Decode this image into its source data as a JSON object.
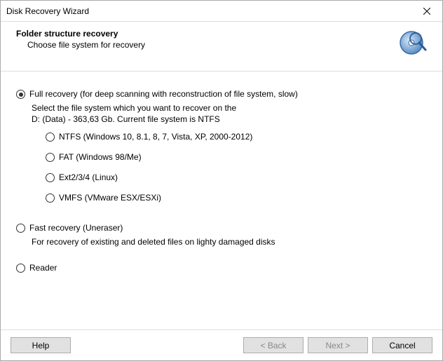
{
  "window": {
    "title": "Disk Recovery Wizard"
  },
  "header": {
    "heading": "Folder structure recovery",
    "sub": "Choose file system for recovery"
  },
  "options": {
    "full": {
      "label": "Full recovery (for deep scanning with reconstruction of file system, slow)",
      "desc_line1": "Select the file system which you want to recover on the",
      "desc_line2": "D: (Data) - 363,63 Gb. Current file system is NTFS",
      "selected": true,
      "fs": [
        {
          "label": "NTFS (Windows 10, 8.1, 8, 7, Vista, XP, 2000-2012)",
          "selected": false
        },
        {
          "label": "FAT (Windows 98/Me)",
          "selected": false
        },
        {
          "label": "Ext2/3/4 (Linux)",
          "selected": false
        },
        {
          "label": "VMFS (VMware ESX/ESXi)",
          "selected": false
        }
      ]
    },
    "fast": {
      "label": "Fast recovery (Uneraser)",
      "desc": "For recovery of existing and deleted files on lighty damaged disks",
      "selected": false
    },
    "reader": {
      "label": "Reader",
      "selected": false
    }
  },
  "footer": {
    "help": "Help",
    "back": "< Back",
    "next": "Next >",
    "cancel": "Cancel",
    "back_enabled": false,
    "next_enabled": false
  }
}
